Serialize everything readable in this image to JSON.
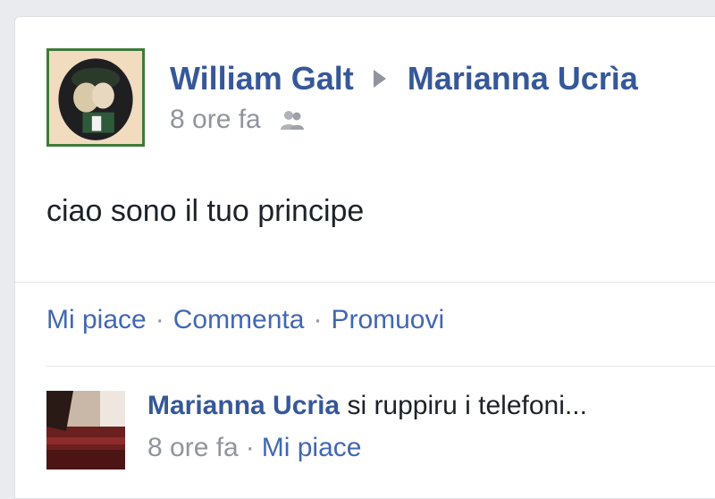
{
  "post": {
    "author": "William Galt",
    "target": "Marianna Ucrìa",
    "time": "8 ore fa",
    "audience_icon": "friends-icon",
    "text": "ciao sono il tuo principe"
  },
  "actions": {
    "like": "Mi piace",
    "comment": "Commenta",
    "promote": "Promuovi",
    "separator": "·"
  },
  "comment": {
    "author": "Marianna Ucrìa",
    "text": "si ruppiru i telefoni...",
    "time": "8 ore fa",
    "like": "Mi piace",
    "separator": "·"
  },
  "colors": {
    "link": "#365899",
    "action": "#4267b2",
    "meta": "#90949c",
    "text": "#1d2129",
    "background": "#e9ebee"
  }
}
